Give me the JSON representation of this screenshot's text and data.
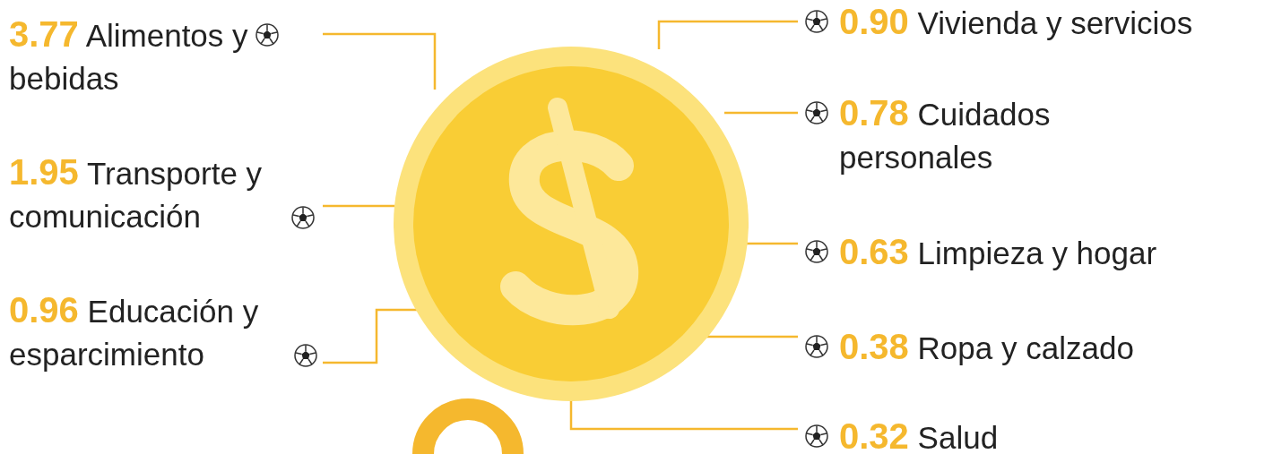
{
  "left_items": [
    {
      "value": "3.77",
      "label": "Alimentos y bebidas"
    },
    {
      "value": "1.95",
      "label": "Transporte y comunicación"
    },
    {
      "value": "0.96",
      "label": "Educación y esparcimiento"
    }
  ],
  "right_items": [
    {
      "value": "0.90",
      "label": "Vivienda y servicios"
    },
    {
      "value": "0.78",
      "label": "Cuidados personales"
    },
    {
      "value": "0.63",
      "label": "Limpieza y hogar"
    },
    {
      "value": "0.38",
      "label": "Ropa y calzado"
    },
    {
      "value": "0.32",
      "label": "Salud"
    }
  ]
}
